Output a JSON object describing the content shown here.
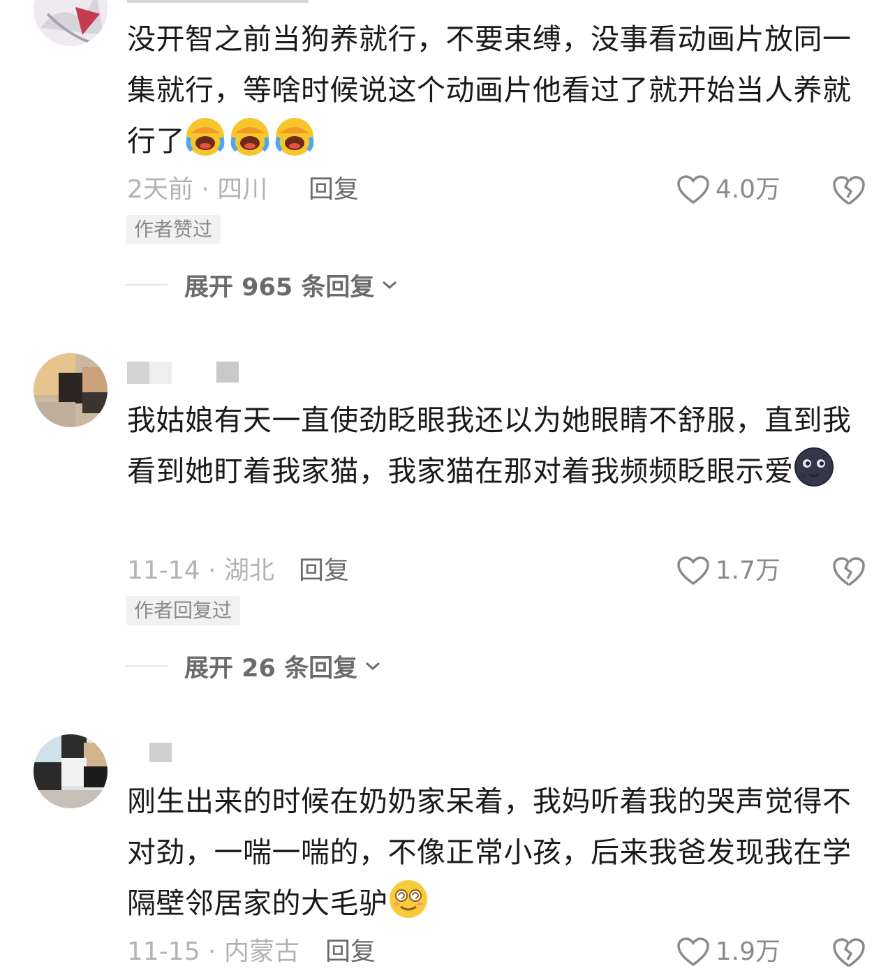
{
  "comments": [
    {
      "text": "没开智之前当狗养就行，不要束缚，没事看动画片放同一集就行，等啥时候说这个动画片他看过了就开始当人养就行了",
      "emojis": [
        "laugh-cry-emoji",
        "laugh-cry-emoji",
        "laugh-cry-emoji"
      ],
      "meta": "2天前 · 四川",
      "reply_label": "回复",
      "likes": "4.0万",
      "badge": "作者赞过",
      "expand_label": "展开 965 条回复"
    },
    {
      "text": "我姑娘有天一直使劲眨眼我还以为她眼睛不舒服，直到我看到她盯着我家猫，我家猫在那对着我频频眨眼示爱",
      "emojis": [
        "moon-face-emoji"
      ],
      "meta": "11-14 · 湖北",
      "reply_label": "回复",
      "likes": "1.7万",
      "badge": "作者回复过",
      "expand_label": "展开 26 条回复"
    },
    {
      "text": "刚生出来的时候在奶奶家呆着，我妈听着我的哭声觉得不对劲，一喘一喘的，不像正常小孩，后来我爸发现我在学隔壁邻居家的大毛驴",
      "emojis": [
        "dizzy-smile-emoji"
      ],
      "meta": "11-15 · 内蒙古",
      "reply_label": "回复",
      "likes": "1.9万"
    }
  ],
  "colors": {
    "text": "#1a1a1a",
    "meta": "#b3b3b3",
    "secondary": "#6b6b6b",
    "badge_bg": "#f1f1f1"
  }
}
